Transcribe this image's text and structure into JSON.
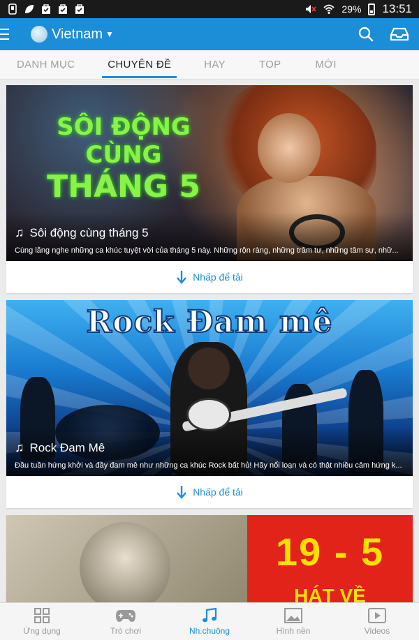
{
  "status_bar": {
    "battery": "29%",
    "time": "13:51"
  },
  "app_bar": {
    "region": "Vietnam"
  },
  "tabs": [
    {
      "label": "DANH MỤC",
      "active": false
    },
    {
      "label": "CHUYÊN ĐỀ",
      "active": true
    },
    {
      "label": "HAY",
      "active": false
    },
    {
      "label": "TOP",
      "active": false
    },
    {
      "label": "MỚI",
      "active": false
    }
  ],
  "cards": [
    {
      "banner_text": [
        "SÔI ĐỘNG",
        "CÙNG",
        "THÁNG 5"
      ],
      "title": "Sôi động cùng tháng 5",
      "description": "Cùng lắng nghe những ca khúc tuyệt vời của tháng 5 này. Những rộn ràng, những trầm tư, những tâm sự, nhữ...",
      "action": "Nhấp để tải"
    },
    {
      "banner_text": [
        "Rock Đam mê"
      ],
      "title": "Rock Đam Mê",
      "description": "Đầu tuần hứng khởi và đầy đam mê như những ca khúc Rock bất hủ! Hãy nổi loạn và có thật nhiều cảm hứng k...",
      "action": "Nhấp để tải"
    },
    {
      "banner_text": [
        "19 - 5",
        "HÁT VỀ"
      ]
    }
  ],
  "bottom_nav": [
    {
      "label": "Ứng dụng",
      "icon": "apps-grid-icon",
      "active": false
    },
    {
      "label": "Trò chơi",
      "icon": "gamepad-icon",
      "active": false
    },
    {
      "label": "Nh.chuông",
      "icon": "music-note-icon",
      "active": true
    },
    {
      "label": "Hình nền",
      "icon": "wallpaper-icon",
      "active": false
    },
    {
      "label": "Videos",
      "icon": "video-icon",
      "active": false
    }
  ],
  "colors": {
    "primary": "#1c8ed8",
    "status_bar": "#1a1a1a"
  }
}
